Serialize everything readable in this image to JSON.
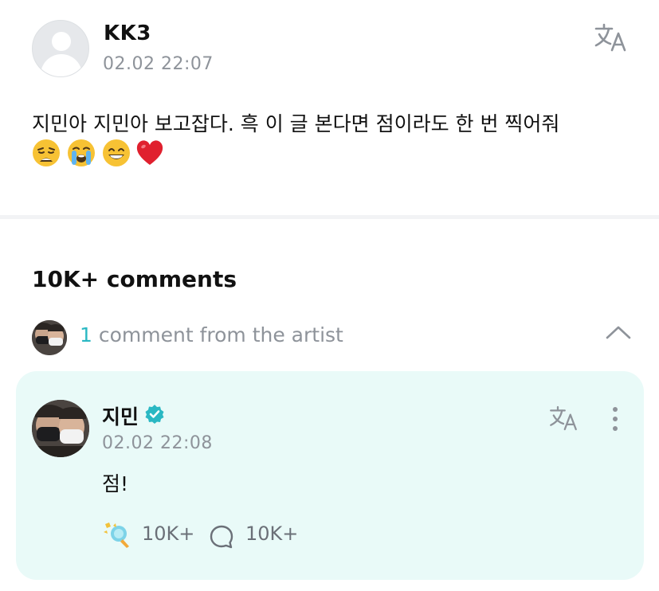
{
  "post": {
    "author": "KK3",
    "timestamp": "02.02 22:07",
    "text": "지민아 지민아 보고잡다.  흑 이 글 본다면 점이라도 한 번 찍어줘",
    "emojis": [
      "weary-face",
      "loudly-crying-face",
      "grinning-face-with-smiling-eyes",
      "red-heart"
    ]
  },
  "comments": {
    "count_label": "10K+ comments",
    "artist_summary": {
      "count": "1",
      "label": " comment from the artist"
    }
  },
  "artist_comment": {
    "author": "지민",
    "timestamp": "02.02 22:08",
    "text": "점!",
    "likes": "10K+",
    "replies": "10K+"
  },
  "colors": {
    "accent": "#2ab8c3",
    "card_background": "#e9faf8",
    "muted_text": "#8e939a"
  },
  "icons": [
    "translate-icon",
    "chevron-up-icon",
    "verified-badge-icon",
    "more-vertical-icon",
    "lightstick-icon",
    "reply-bubble-icon"
  ]
}
